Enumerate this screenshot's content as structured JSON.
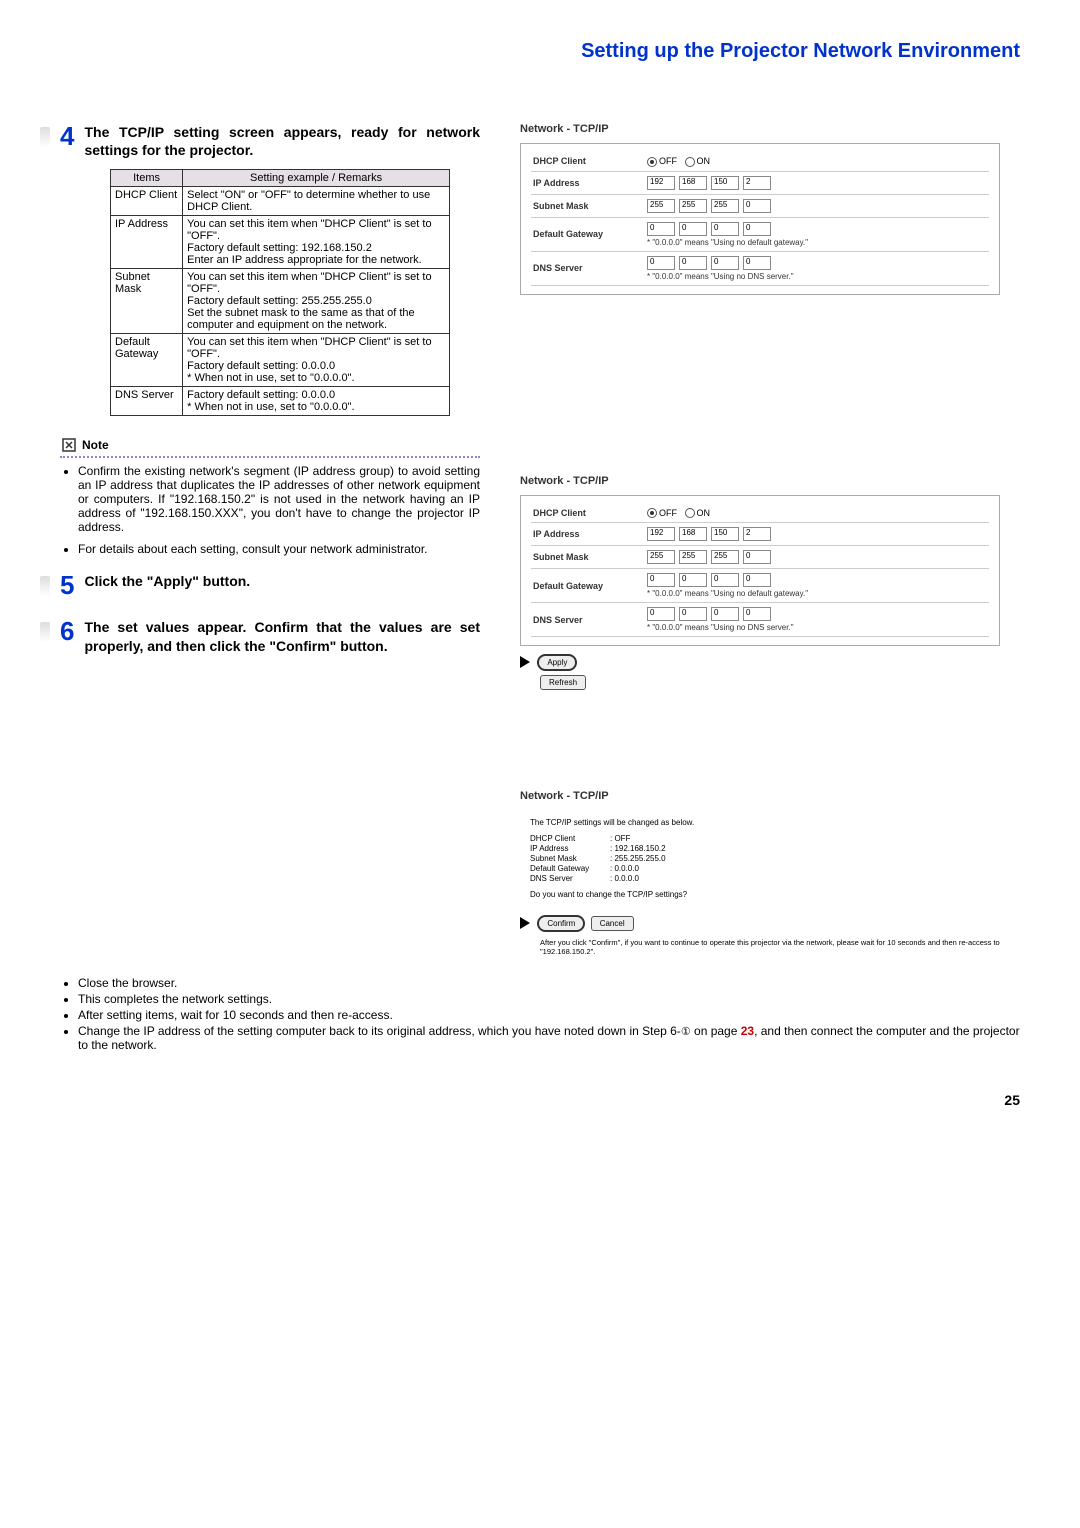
{
  "title": "Setting up the Projector Network Environment",
  "step4": {
    "num": "4",
    "heading": "The TCP/IP setting screen appears, ready for network settings for the projector.",
    "table_headers": [
      "Items",
      "Setting example / Remarks"
    ],
    "rows": [
      {
        "item": "DHCP Client",
        "remark": "Select \"ON\" or \"OFF\" to determine whether to use DHCP Client."
      },
      {
        "item": "IP Address",
        "remark": "You can set this item when \"DHCP Client\" is set to \"OFF\".\nFactory default setting: 192.168.150.2\nEnter an IP address appropriate for the network."
      },
      {
        "item": "Subnet Mask",
        "remark": "You can set this item when \"DHCP Client\" is set to \"OFF\".\nFactory default setting: 255.255.255.0\nSet the subnet mask to the same as that of the computer and equipment on the network."
      },
      {
        "item": "Default Gateway",
        "remark": "You can set this item when \"DHCP Client\" is set to \"OFF\".\nFactory default setting: 0.0.0.0\n* When not in use, set to \"0.0.0.0\"."
      },
      {
        "item": "DNS Server",
        "remark": "Factory default setting: 0.0.0.0\n* When not in use, set to \"0.0.0.0\"."
      }
    ]
  },
  "note": {
    "label": "Note",
    "items": [
      "Confirm the existing network's segment (IP address group) to avoid setting an IP address that duplicates the IP addresses of other network equipment or computers. If \"192.168.150.2\" is not used in the network having an IP address of \"192.168.150.XXX\", you don't have to change the projector IP address.",
      "For details about each setting, consult your network administrator."
    ]
  },
  "step5": {
    "num": "5",
    "heading": "Click the \"Apply\" button."
  },
  "step6": {
    "num": "6",
    "heading": "The set values appear. Confirm that the values are set properly, and then click the \"Confirm\" button."
  },
  "bottom": {
    "items": [
      "Close the browser.",
      "This completes the network settings.",
      "After setting items, wait for 10 seconds and then re-access.",
      "Change the IP address of the setting computer back to its original address, which you have noted down in Step 6-"
    ],
    "item4_cont": " on page ",
    "page_link": "23",
    "item4_end": ", and then connect the computer and the projector to the network.",
    "circled": "①"
  },
  "panel": {
    "title": "Network - TCP/IP",
    "dhcp_label": "DHCP Client",
    "off": "OFF",
    "on": "ON",
    "ip_label": "IP Address",
    "ip": [
      "192",
      "168",
      "150",
      "2"
    ],
    "mask_label": "Subnet Mask",
    "mask": [
      "255",
      "255",
      "255",
      "0"
    ],
    "gw_label": "Default Gateway",
    "gw": [
      "0",
      "0",
      "0",
      "0"
    ],
    "gw_hint": "* \"0.0.0.0\" means \"Using no default gateway.\"",
    "dns_label": "DNS Server",
    "dns": [
      "0",
      "0",
      "0",
      "0"
    ],
    "dns_hint": "* \"0.0.0.0\" means \"Using no DNS server.\"",
    "apply": "Apply",
    "refresh": "Refresh"
  },
  "confirm_panel": {
    "title": "Network - TCP/IP",
    "msg": "The TCP/IP settings will be changed as below.",
    "lines": [
      {
        "k": "DHCP Client",
        "v": ": OFF"
      },
      {
        "k": "IP Address",
        "v": ": 192.168.150.2"
      },
      {
        "k": "Subnet Mask",
        "v": ": 255.255.255.0"
      },
      {
        "k": "Default Gateway",
        "v": ": 0.0.0.0"
      },
      {
        "k": "DNS Server",
        "v": ": 0.0.0.0"
      }
    ],
    "question": "Do you want to change the TCP/IP settings?",
    "confirm": "Confirm",
    "cancel": "Cancel",
    "note": "After you click \"Confirm\", if you want to continue to operate this projector via the network, please wait for 10 seconds and then re-access to \"192.168.150.2\"."
  },
  "page_number": "25"
}
